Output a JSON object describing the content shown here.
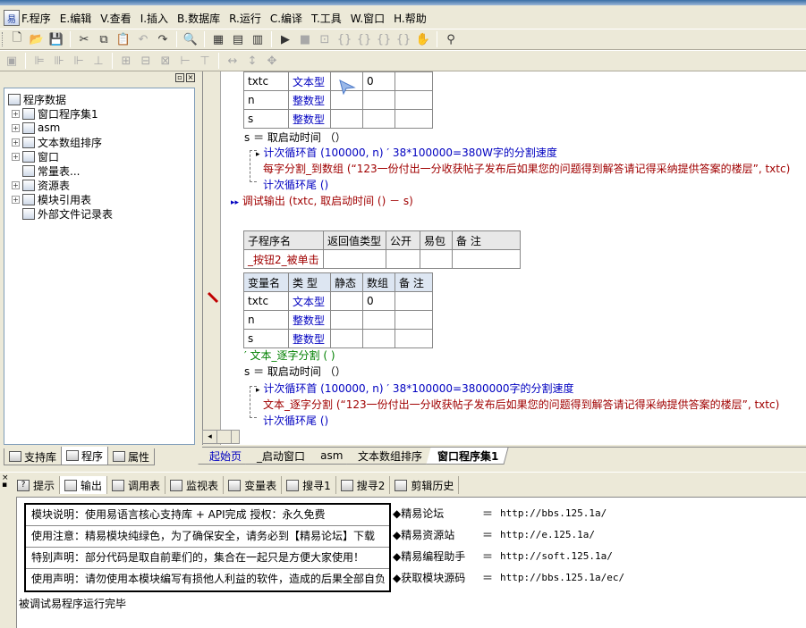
{
  "menu": {
    "items": [
      {
        "label": "F.程序"
      },
      {
        "label": "E.编辑"
      },
      {
        "label": "V.查看"
      },
      {
        "label": "I.插入"
      },
      {
        "label": "B.数据库"
      },
      {
        "label": "R.运行"
      },
      {
        "label": "C.编译"
      },
      {
        "label": "T.工具"
      },
      {
        "label": "W.窗口"
      },
      {
        "label": "H.帮助"
      }
    ]
  },
  "toolbar1": {
    "icons": [
      "new-icon",
      "open-icon",
      "save-icon",
      "cut-icon",
      "copy-icon",
      "paste-icon",
      "undo-icon",
      "redo-icon",
      "find-icon",
      "layout-1-icon",
      "layout-2-icon",
      "layout-3-icon",
      "run-icon",
      "stop-icon",
      "step-1-icon",
      "step-2-icon",
      "step-3-icon",
      "step-4-icon",
      "step-5-icon",
      "hand-icon",
      "search-binoculars-icon"
    ]
  },
  "left_panel": {
    "tree": [
      {
        "label": "程序数据",
        "level": 0,
        "expand": ""
      },
      {
        "label": "窗口程序集1",
        "level": 1,
        "expand": "+"
      },
      {
        "label": "asm",
        "level": 1,
        "expand": "+"
      },
      {
        "label": "文本数组排序",
        "level": 1,
        "expand": "+"
      },
      {
        "label": "窗口",
        "level": 1,
        "expand": "+"
      },
      {
        "label": "常量表...",
        "level": 1,
        "expand": ""
      },
      {
        "label": "资源表",
        "level": 1,
        "expand": "+"
      },
      {
        "label": "模块引用表",
        "level": 1,
        "expand": "+"
      },
      {
        "label": "外部文件记录表",
        "level": 1,
        "expand": ""
      }
    ],
    "tabs": [
      {
        "label": "支持库"
      },
      {
        "label": "程序"
      },
      {
        "label": "属性"
      }
    ]
  },
  "code": {
    "table1_rows": [
      {
        "name": "txtc",
        "type": "文本型",
        "static": "",
        "array": "0",
        "note": ""
      },
      {
        "name": "n",
        "type": "整数型",
        "static": "",
        "array": "",
        "note": ""
      },
      {
        "name": "s",
        "type": "整数型",
        "static": "",
        "array": "",
        "note": ""
      }
    ],
    "line1": "s ＝ 取启动时间 （）",
    "line2": "计次循环首 (100000, n)  ′ 38*100000=380W字的分割速度",
    "line3": "每字分割_到数组 (“123一份付出一分收获帖子发布后如果您的问题得到解答请记得采纳提供答案的楼层”, txtc)",
    "line4": "计次循环尾 ()",
    "line5": "调试输出 (txtc, 取启动时间 () － s)",
    "sub_header": [
      "子程序名",
      "返回值类型",
      "公开",
      "易包",
      "备 注"
    ],
    "sub_row": [
      "_按钮2_被单击",
      "",
      "",
      "",
      ""
    ],
    "table2_header": [
      "变量名",
      "类 型",
      "静态",
      "数组",
      "备 注"
    ],
    "table2_rows": [
      {
        "name": "txtc",
        "type": "文本型",
        "static": "",
        "array": "0",
        "note": ""
      },
      {
        "name": "n",
        "type": "整数型",
        "static": "",
        "array": "",
        "note": ""
      },
      {
        "name": "s",
        "type": "整数型",
        "static": "",
        "array": "",
        "note": ""
      }
    ],
    "line6": "′ 文本_逐字分割 ( )",
    "line7": "s ＝ 取启动时间 （）",
    "line8": "计次循环首 (100000, n)  ′ 38*100000=3800000字的分割速度",
    "line9": "文本_逐字分割 (“123一份付出一分收获帖子发布后如果您的问题得到解答请记得采纳提供答案的楼层”, txtc)",
    "line10": "计次循环尾 ()"
  },
  "doc_tabs": [
    {
      "label": "起始页"
    },
    {
      "label": "_启动窗口"
    },
    {
      "label": "asm"
    },
    {
      "label": "文本数组排序"
    },
    {
      "label": "窗口程序集1"
    }
  ],
  "bottom_tabs": [
    {
      "label": "提示"
    },
    {
      "label": "输出"
    },
    {
      "label": "调用表"
    },
    {
      "label": "监视表"
    },
    {
      "label": "变量表"
    },
    {
      "label": "搜寻1"
    },
    {
      "label": "搜寻2"
    },
    {
      "label": "剪辑历史"
    }
  ],
  "output": {
    "info_rows": [
      "模块说明：使用易语言核心支持库 + API完成       授权：永久免费",
      "使用注意：精易模块纯绿色，为了确保安全，请务必到【精易论坛】下载",
      "特别声明：部分代码是取自前辈们的，集合在一起只是方便大家使用！",
      "使用声明：请勿使用本模块编写有损他人利益的软件，造成的后果全部自负"
    ],
    "links": [
      {
        "name": "◆精易论坛",
        "eq": "＝",
        "url": "http://bbs.125.1a/"
      },
      {
        "name": "◆精易资源站",
        "eq": "＝",
        "url": "http://e.125.1a/"
      },
      {
        "name": "◆精易编程助手",
        "eq": "＝",
        "url": "http://soft.125.1a/"
      },
      {
        "name": "◆获取模块源码",
        "eq": "＝",
        "url": "http://bbs.125.1a/ec/"
      }
    ],
    "status": "被调试易程序运行完毕"
  }
}
